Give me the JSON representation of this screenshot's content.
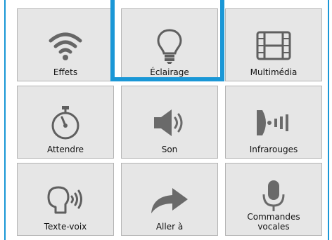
{
  "colors": {
    "selection": "#1a97d6",
    "tile_bg": "#e6e6e6",
    "icon": "#5f5f5f"
  },
  "tiles": [
    {
      "label": "Effets",
      "icon": "wifi-icon",
      "selected": false
    },
    {
      "label": "Éclairage",
      "icon": "lightbulb-icon",
      "selected": true
    },
    {
      "label": "Multimédia",
      "icon": "film-icon",
      "selected": false
    },
    {
      "label": "Attendre",
      "icon": "stopwatch-icon",
      "selected": false
    },
    {
      "label": "Son",
      "icon": "speaker-icon",
      "selected": false
    },
    {
      "label": "Infrarouges",
      "icon": "infrared-icon",
      "selected": false
    },
    {
      "label": "Texte-voix",
      "icon": "text-to-speech-icon",
      "selected": false
    },
    {
      "label": "Aller à",
      "icon": "arrow-redo-icon",
      "selected": false
    },
    {
      "label": "Commandes\nvocales",
      "icon": "microphone-icon",
      "selected": false
    }
  ]
}
